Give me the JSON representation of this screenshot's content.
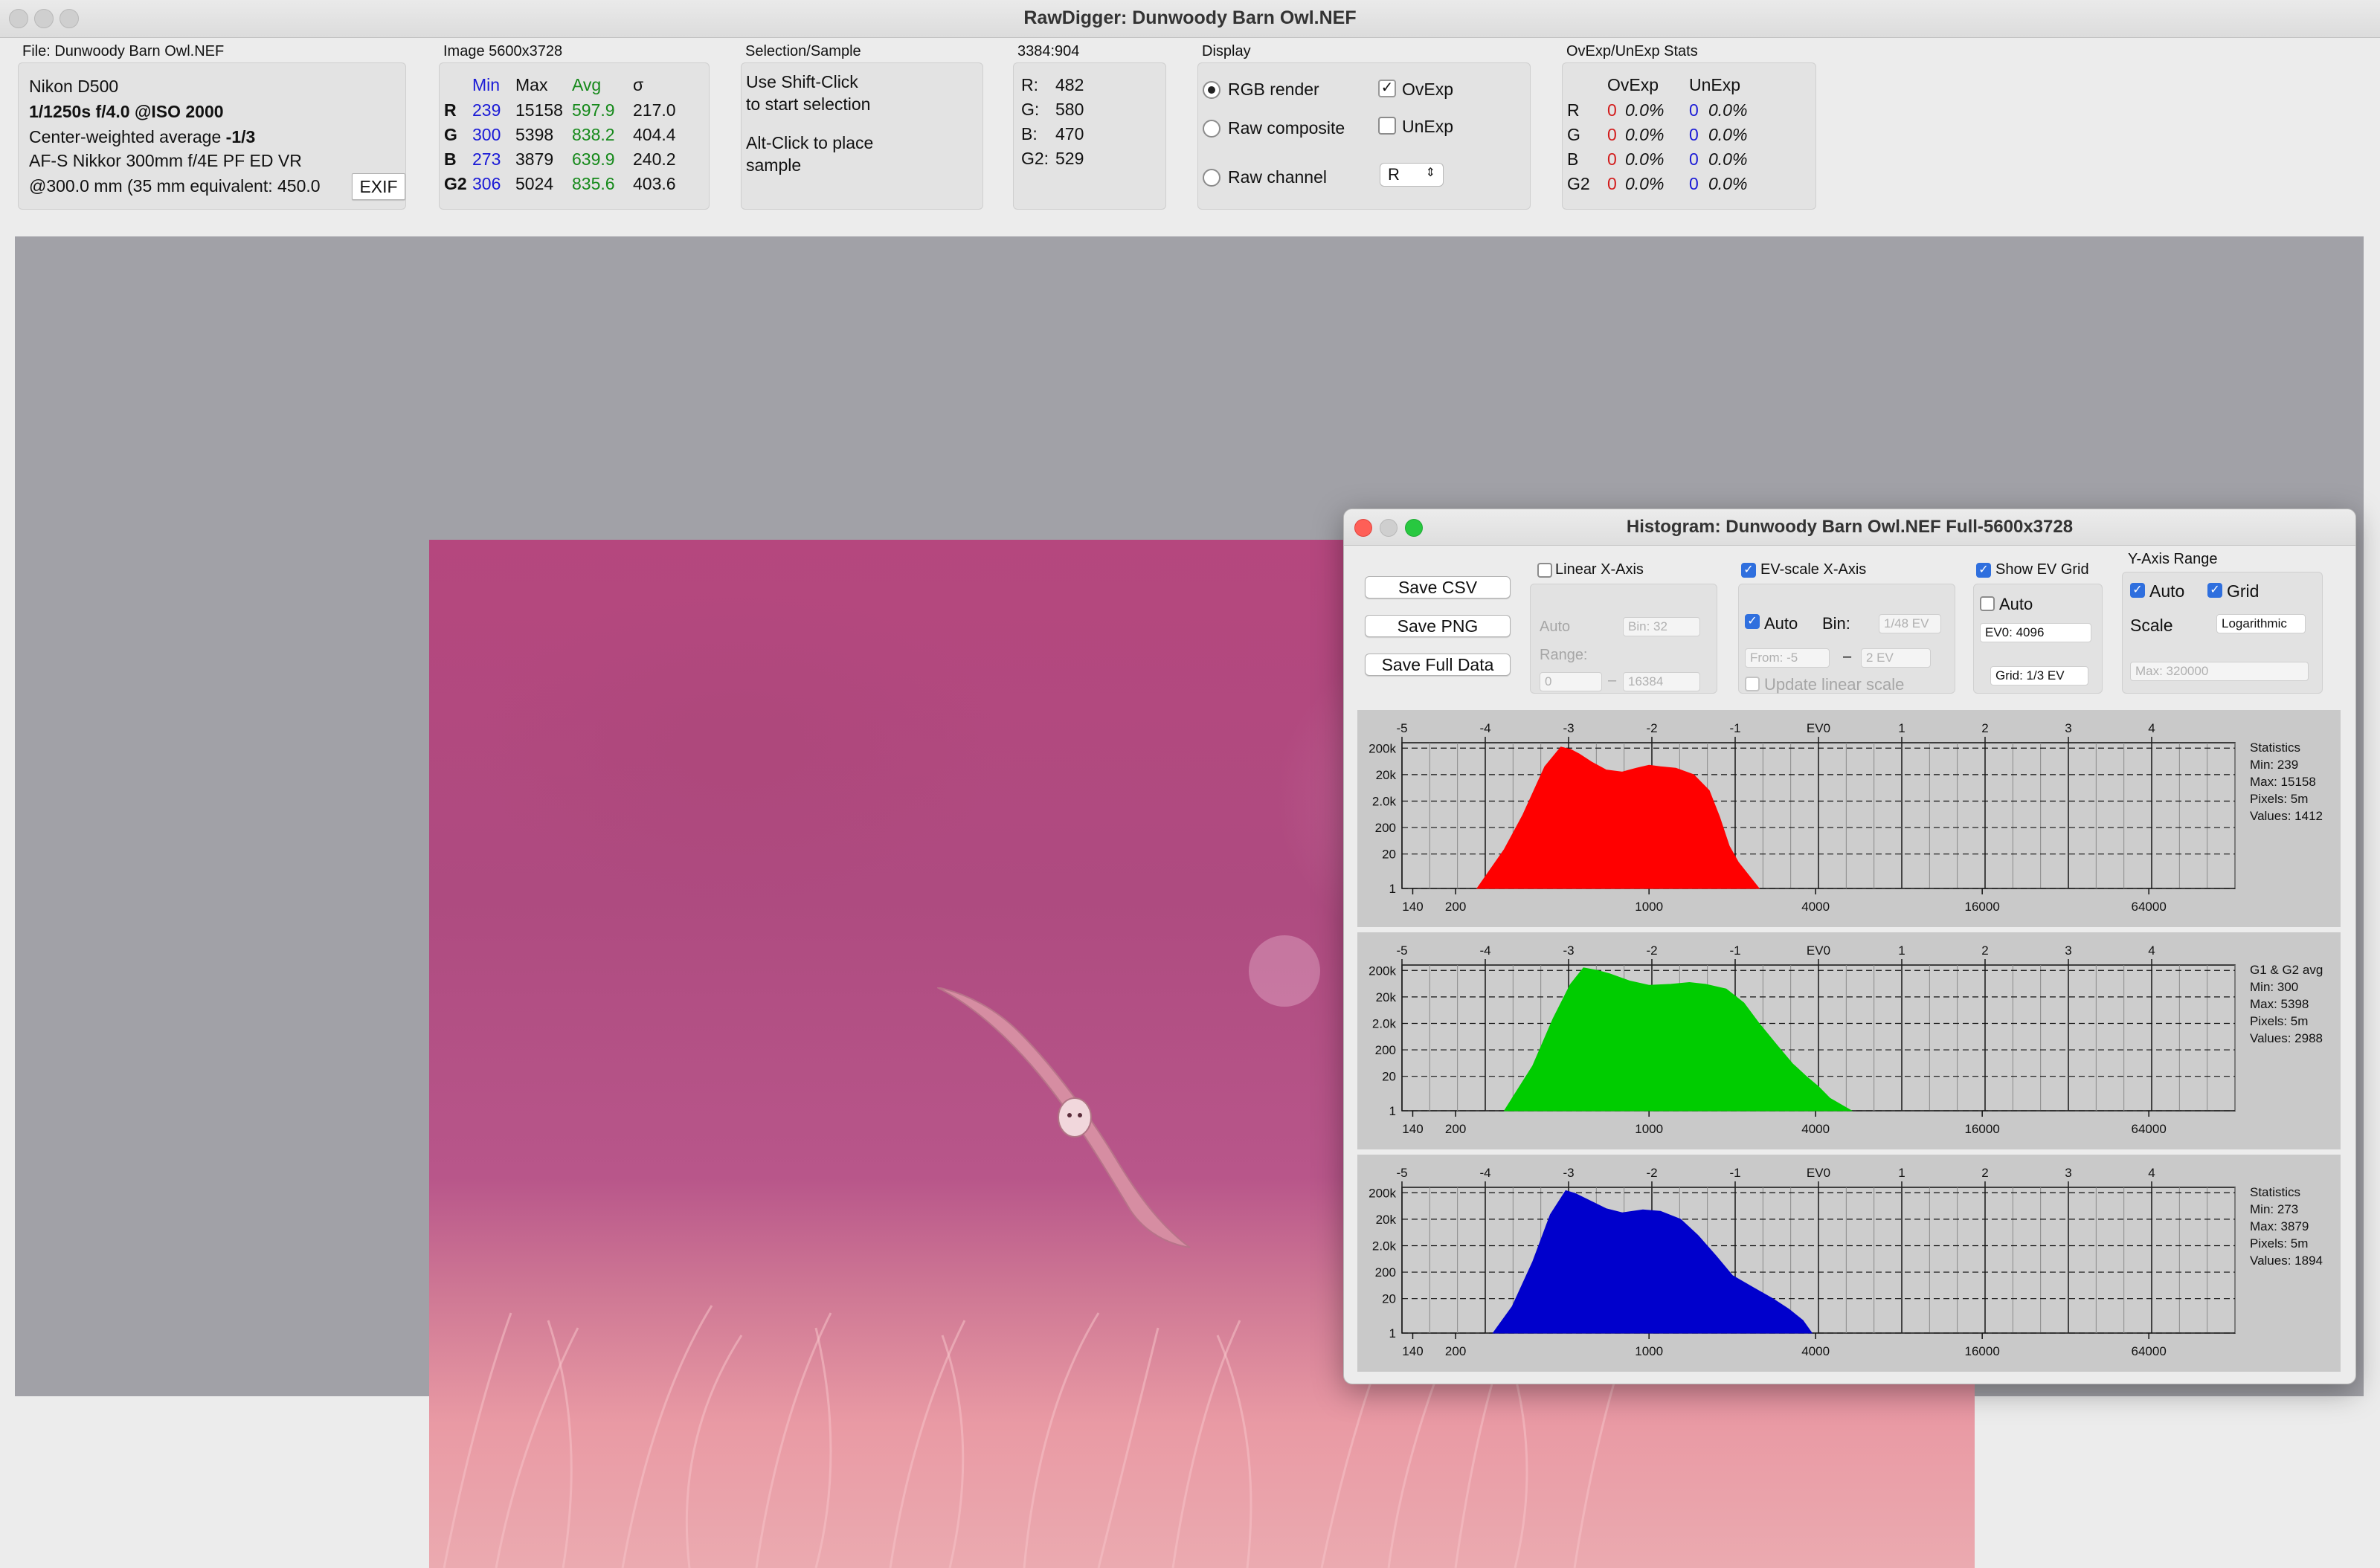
{
  "window": {
    "title": "RawDigger: Dunwoody Barn Owl.NEF"
  },
  "file": {
    "label": "File: Dunwoody Barn Owl.NEF",
    "camera": "Nikon D500",
    "exposure": "1/1250s f/4.0 @ISO 2000",
    "metering_prefix": "Center-weighted average",
    "metering_value": "-1/3",
    "lens": "AF-S Nikkor 300mm f/4E PF ED VR",
    "focal": "@300.0 mm (35 mm equivalent: 450.0",
    "exif_button": "EXIF"
  },
  "image_stats": {
    "label": "Image 5600x3728",
    "headers": [
      "Min",
      "Max",
      "Avg",
      "σ"
    ],
    "rows": [
      {
        "ch": "R",
        "min": "239",
        "max": "15158",
        "avg": "597.9",
        "sd": "217.0"
      },
      {
        "ch": "G",
        "min": "300",
        "max": "5398",
        "avg": "838.2",
        "sd": "404.4"
      },
      {
        "ch": "B",
        "min": "273",
        "max": "3879",
        "avg": "639.9",
        "sd": "240.2"
      },
      {
        "ch": "G2",
        "min": "306",
        "max": "5024",
        "avg": "835.6",
        "sd": "403.6"
      }
    ]
  },
  "selection": {
    "label": "Selection/Sample",
    "line1": "Use Shift-Click",
    "line2": "to start selection",
    "line3": "Alt-Click to place",
    "line4": "sample"
  },
  "coords": {
    "label": "3384:904",
    "rows": [
      {
        "ch": "R:",
        "val": "482"
      },
      {
        "ch": "G:",
        "val": "580"
      },
      {
        "ch": "B:",
        "val": "470"
      },
      {
        "ch": "G2:",
        "val": "529"
      }
    ]
  },
  "display": {
    "label": "Display",
    "rgb_render": "RGB render",
    "raw_composite": "Raw composite",
    "raw_channel": "Raw channel",
    "ovexp": "OvExp",
    "unexp": "UnExp",
    "channel_value": "R"
  },
  "ovexp_stats": {
    "label": "OvExp/UnExp Stats",
    "headers": [
      "OvExp",
      "UnExp"
    ],
    "rows": [
      {
        "ch": "R",
        "ov": "0",
        "ovp": "0.0%",
        "un": "0",
        "unp": "0.0%"
      },
      {
        "ch": "G",
        "ov": "0",
        "ovp": "0.0%",
        "un": "0",
        "unp": "0.0%"
      },
      {
        "ch": "B",
        "ov": "0",
        "ovp": "0.0%",
        "un": "0",
        "unp": "0.0%"
      },
      {
        "ch": "G2",
        "ov": "0",
        "ovp": "0.0%",
        "un": "0",
        "unp": "0.0%"
      }
    ]
  },
  "histogram": {
    "title": "Histogram: Dunwoody Barn Owl.NEF Full-5600x3728",
    "save_csv": "Save CSV",
    "save_png": "Save PNG",
    "save_full": "Save Full Data",
    "linear_x": "Linear X-Axis",
    "auto": "Auto",
    "bin_label": "Bin:",
    "linear_bin": "Bin: 32",
    "range_label": "Range:",
    "range_from": "0",
    "range_to": "16384",
    "ev_x": "EV-scale X-Axis",
    "ev_bin": "1/48 EV",
    "ev_from": "From: -5",
    "ev_to": "2 EV",
    "update_linear": "Update linear scale",
    "show_ev_grid": "Show EV Grid",
    "ev0_field": "EV0: 4096",
    "grid_field": "Grid: 1/3 EV",
    "y_axis_range": "Y-Axis Range",
    "grid": "Grid",
    "scale": "Scale",
    "scale_value": "Logarithmic",
    "max_field": "Max: 320000",
    "dash": "–"
  },
  "chart_data": {
    "type": "area",
    "x_scale": "log2 (EV)",
    "ev_ticks": [
      "-5",
      "-4",
      "-3",
      "-2",
      "-1",
      "EV0",
      "1",
      "2",
      "3",
      "4"
    ],
    "ev_values": [
      -5,
      -4,
      -3,
      -2,
      -1,
      0,
      1,
      2,
      3,
      4
    ],
    "x_ticks": [
      "140",
      "200",
      "1000",
      "4000",
      "16000",
      "64000"
    ],
    "x_tick_values": [
      140,
      200,
      1000,
      4000,
      16000,
      64000
    ],
    "y_ticks": [
      "200k",
      "20k",
      "2.0k",
      "200",
      "20",
      "1"
    ],
    "y_tick_values": [
      200000,
      20000,
      2000,
      200,
      20,
      1
    ],
    "ylim": [
      1,
      320000
    ],
    "series": [
      {
        "name": "R",
        "color": "#ff0000",
        "stats": [
          "Statistics",
          "Min: 239",
          "Max: 15158",
          "Pixels: 5m",
          "Values: 1412"
        ],
        "x": [
          239,
          300,
          350,
          420,
          480,
          520,
          560,
          620,
          700,
          800,
          900,
          1000,
          1100,
          1250,
          1450,
          1650,
          1800,
          1950,
          2100,
          2300,
          2500
        ],
        "y": [
          1,
          30,
          600,
          40000,
          220000,
          180000,
          120000,
          60000,
          30000,
          25000,
          35000,
          45000,
          40000,
          35000,
          20000,
          5000,
          500,
          40,
          10,
          3,
          1
        ]
      },
      {
        "name": "G1 & G2 avg",
        "color": "#00cc00",
        "stats": [
          "G1 & G2 avg",
          "Min: 300",
          "Max: 5398",
          "Pixels: 5m",
          "Values: 2988"
        ],
        "x": [
          300,
          380,
          450,
          520,
          580,
          650,
          720,
          850,
          1000,
          1200,
          1400,
          1600,
          1900,
          2200,
          2500,
          2900,
          3300,
          3700,
          4100,
          4500,
          5398
        ],
        "y": [
          1,
          50,
          3000,
          60000,
          250000,
          200000,
          150000,
          80000,
          55000,
          60000,
          70000,
          60000,
          40000,
          12000,
          2000,
          300,
          60,
          20,
          8,
          3,
          1
        ]
      },
      {
        "name": "B",
        "color": "#0000cc",
        "stats": [
          "Statistics",
          "Min: 273",
          "Max: 3879",
          "Pixels: 5m",
          "Values: 1894"
        ],
        "x": [
          273,
          320,
          380,
          440,
          500,
          540,
          600,
          700,
          800,
          950,
          1100,
          1300,
          1500,
          1750,
          2000,
          2400,
          2800,
          3200,
          3600,
          3879
        ],
        "y": [
          1,
          10,
          500,
          30000,
          240000,
          190000,
          110000,
          50000,
          35000,
          45000,
          40000,
          20000,
          5000,
          800,
          150,
          50,
          20,
          8,
          3,
          1
        ]
      }
    ]
  }
}
